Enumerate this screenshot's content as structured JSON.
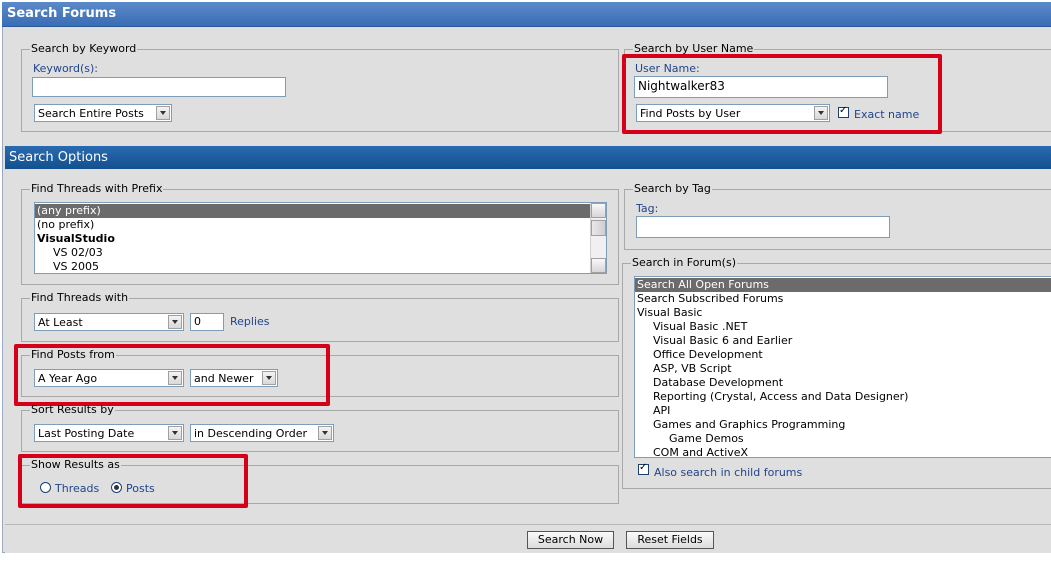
{
  "title_bar": {
    "text": "Search Forums"
  },
  "keyword_section": {
    "legend": "Search by Keyword",
    "label": "Keyword(s):",
    "value": "",
    "scope_select": "Search Entire Posts"
  },
  "user_section": {
    "legend": "Search by User Name",
    "label": "User Name:",
    "value": "Nightwalker83",
    "mode_select": "Find Posts by User",
    "exact_label": "Exact name",
    "exact_checked": true
  },
  "options_bar": {
    "text": "Search Options"
  },
  "prefix_section": {
    "legend": "Find Threads with Prefix",
    "items": [
      {
        "label": "(any prefix)",
        "selected": true
      },
      {
        "label": "(no prefix)"
      },
      {
        "label": "VisualStudio",
        "bold": true
      },
      {
        "label": "VS 02/03",
        "indent": 1
      },
      {
        "label": "VS 2005",
        "indent": 1
      }
    ]
  },
  "threads_with_section": {
    "legend": "Find Threads with",
    "qualifier": "At Least",
    "count": "0",
    "unit_label": "Replies"
  },
  "posts_from_section": {
    "legend": "Find Posts from",
    "period": "A Year Ago",
    "direction": "and Newer"
  },
  "sort_section": {
    "legend": "Sort Results by",
    "field": "Last Posting Date",
    "order": "in Descending Order"
  },
  "show_results_section": {
    "legend": "Show Results as",
    "threads_label": "Threads",
    "posts_label": "Posts",
    "selected": "Posts"
  },
  "tag_section": {
    "legend": "Search by Tag",
    "label": "Tag:",
    "value": ""
  },
  "forum_section": {
    "legend": "Search in Forum(s)",
    "items": [
      {
        "label": "Search All Open Forums",
        "selected": true
      },
      {
        "label": "Search Subscribed Forums"
      },
      {
        "label": "Visual Basic"
      },
      {
        "label": "Visual Basic .NET",
        "indent": 1
      },
      {
        "label": "Visual Basic 6 and Earlier",
        "indent": 1
      },
      {
        "label": "Office Development",
        "indent": 1
      },
      {
        "label": "ASP, VB Script",
        "indent": 1
      },
      {
        "label": "Database Development",
        "indent": 1
      },
      {
        "label": "Reporting (Crystal, Access and Data Designer)",
        "indent": 1
      },
      {
        "label": "API",
        "indent": 1
      },
      {
        "label": "Games and Graphics Programming",
        "indent": 1
      },
      {
        "label": "Game Demos",
        "indent": 2
      },
      {
        "label": "COM and ActiveX",
        "indent": 1
      }
    ],
    "child_label": "Also search in child forums",
    "child_checked": true
  },
  "footer": {
    "search_label": "Search Now",
    "reset_label": "Reset Fields"
  },
  "colors": {
    "title_bar": "#3a6db5",
    "options_bar": "#13508f",
    "highlight": "#d4001a",
    "label": "#22458a"
  }
}
